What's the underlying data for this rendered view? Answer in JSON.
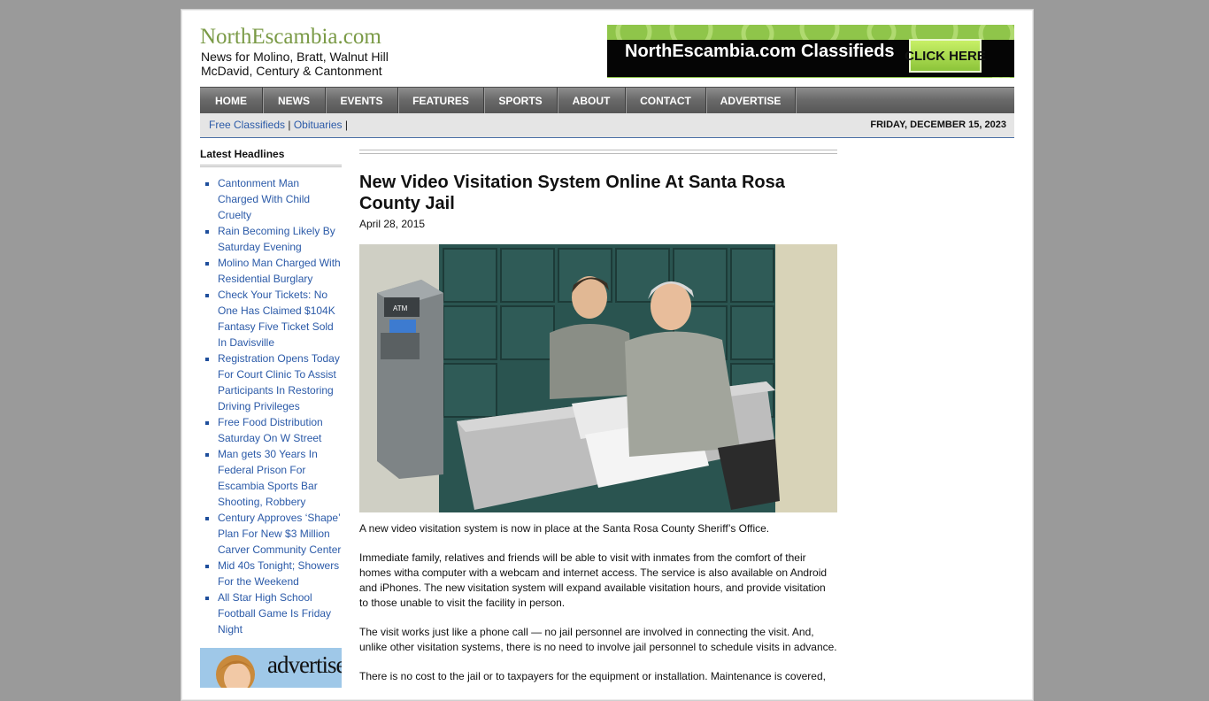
{
  "site": {
    "title": "NorthEscambia.com",
    "tagline_line1": "News for Molino, Bratt, Walnut Hill",
    "tagline_line2": "McDavid, Century & Cantonment"
  },
  "banner": {
    "text": "NorthEscambia.com Classifieds",
    "button": "CLICK HERE"
  },
  "nav": {
    "items": [
      "HOME",
      "NEWS",
      "EVENTS",
      "FEATURES",
      "SPORTS",
      "ABOUT",
      "CONTACT",
      "ADVERTISE"
    ]
  },
  "subnav": {
    "links": [
      "Free Classifieds",
      "Obituaries"
    ],
    "separator": "|",
    "date": "FRIDAY, DECEMBER 15, 2023"
  },
  "sidebar": {
    "heading": "Latest Headlines",
    "headlines": [
      "Cantonment Man Charged With Child Cruelty",
      "Rain Becoming Likely By Saturday Evening",
      "Molino Man Charged With Residential Burglary",
      "Check Your Tickets: No One Has Claimed $104K Fantasy Five Ticket Sold In Davisville",
      "Registration Opens Today For Court Clinic To Assist Participants In Restoring Driving Privileges",
      "Free Food Distribution Saturday On W Street",
      "Man gets 30 Years In Federal Prison For Escambia Sports Bar Shooting, Robbery",
      "Century Approves ‘Shape’ Plan For New $3 Million Carver Community Center",
      "Mid 40s Tonight; Showers For the Weekend",
      "All Star High School Football Game Is Friday Night"
    ],
    "ad_text": "advertise"
  },
  "article": {
    "title": "New Video Visitation System Online At Santa Rosa County Jail",
    "date": "April 28, 2015",
    "photo_atm_label": "ATM",
    "paragraphs": [
      "A new video visitation system is now in place at the Santa Rosa County Sheriff’s Office.",
      "Immediate family, relatives and friends will be able to visit with inmates from the comfort of their homes witha computer with a webcam and internet access.  The service is also available on Android and iPhones. The new visitation system will expand available visitation hours, and provide visitation to those unable to visit the facility in person.",
      "The visit works just like a phone call — no jail personnel are involved in connecting the visit. And, unlike other visitation systems, there is no need to involve jail personnel to schedule visits in advance.",
      "There is no cost to the jail or to taxpayers for the equipment or installation. Maintenance is covered,"
    ]
  },
  "colors": {
    "page_bg": "#9a9a9a",
    "title_green": "#7a9a46",
    "link_blue": "#2b5aa8",
    "nav_gray": "#6a6a6a"
  }
}
